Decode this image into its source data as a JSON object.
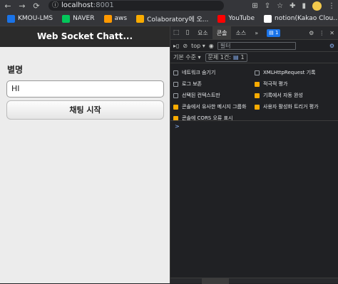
{
  "browser": {
    "url_host": "localhost",
    "url_port": ":8001",
    "bookmarks": [
      {
        "label": "KMOU-LMS",
        "color": "#1a73e8"
      },
      {
        "label": "NAVER",
        "color": "#03c75a"
      },
      {
        "label": "aws",
        "color": "#ff9900"
      },
      {
        "label": "Colaboratory에 오...",
        "color": "#f9ab00"
      },
      {
        "label": "YouTube",
        "color": "#ff0000"
      },
      {
        "label": "notion(Kakao Clou...",
        "color": "#ffffff"
      }
    ]
  },
  "app": {
    "header_title": "Web Socket Chatt...",
    "nickname_label": "별명",
    "nickname_value": "HI",
    "start_button": "채팅 시작"
  },
  "devtools": {
    "tabs": [
      "요소",
      "콘솔",
      "소스"
    ],
    "active_tab": "콘솔",
    "more": "»",
    "error_count": "1",
    "context": "top",
    "filter_placeholder": "필터",
    "levels_label": "기본 수준",
    "issues_label": "문제 1건:",
    "issues_count": "1",
    "settings": [
      {
        "label": "네트워크 숨기기",
        "checked": false
      },
      {
        "label": "XMLHttpRequest 기록",
        "checked": false
      },
      {
        "label": "로그 보존",
        "checked": false
      },
      {
        "label": "적극적 평가",
        "checked": true
      },
      {
        "label": "선택된 컨텍스트만",
        "checked": false
      },
      {
        "label": "기록에서 자동 완성",
        "checked": true
      },
      {
        "label": "콘솔에서 유사한 메시지 그룹화",
        "checked": true
      },
      {
        "label": "사용자 활성화 트리거 평가",
        "checked": true
      },
      {
        "label": "콘솔에 CORS 오류 표시",
        "checked": true
      }
    ],
    "prompt_symbol": ">"
  }
}
